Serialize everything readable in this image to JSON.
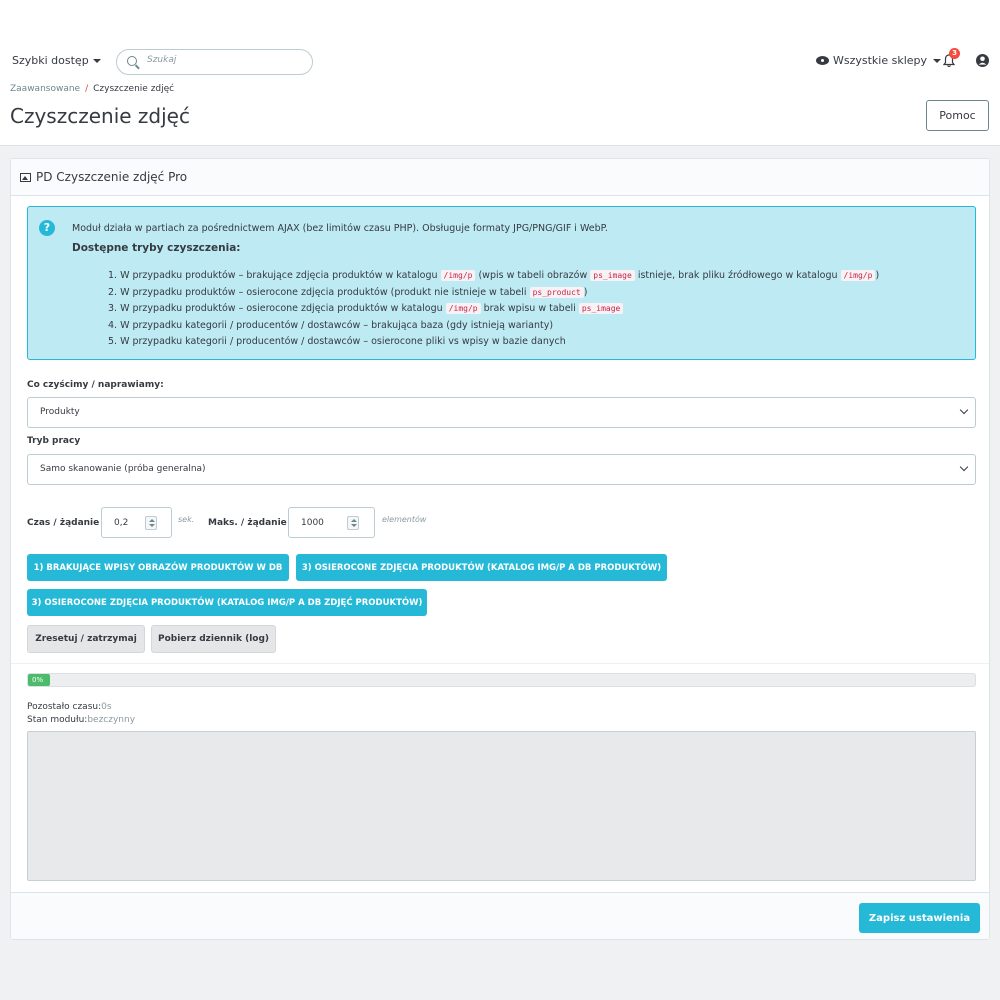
{
  "header": {
    "quick_access": "Szybki dostęp",
    "search_placeholder": "Szukaj",
    "shops": "Wszystkie sklepy",
    "notifications_count": "3"
  },
  "breadcrumb": {
    "parent": "Zaawansowane",
    "separator": "/",
    "current": "Czyszczenie zdjęć"
  },
  "page": {
    "title": "Czyszczenie zdjęć",
    "help_label": "Pomoc"
  },
  "panel": {
    "title": "PD Czyszczenie zdjęć Pro",
    "info": {
      "intro": "Moduł działa w partiach za pośrednictwem AJAX (bez limitów czasu PHP). Obsługuje formaty JPG/PNG/GIF i WebP.",
      "heading": "Dostępne tryby czyszczenia:",
      "modes": [
        {
          "t1": "1. W przypadku produktów – brakujące zdjęcia produktów w katalogu ",
          "c1": "/img/p",
          "t2": " (wpis w tabeli obrazów ",
          "c2": "ps_image",
          "t3": " istnieje, brak pliku źródłowego w katalogu ",
          "c3": "/img/p",
          "t4": ")"
        },
        {
          "t1": "2. W przypadku produktów – osierocone zdjęcia produktów (produkt nie istnieje w tabeli ",
          "c1": "ps_product",
          "t2": ")"
        },
        {
          "t1": "3. W przypadku produktów – osierocone zdjęcia produktów w katalogu ",
          "c1": "/img/p",
          "t2": " brak wpisu w tabeli ",
          "c2": "ps_image"
        },
        {
          "t1": "4. W przypadku kategorii / producentów / dostawców – brakująca baza (gdy istnieją warianty)"
        },
        {
          "t1": "5. W przypadku kategorii / producentów / dostawców – osierocone pliki vs wpisy w bazie danych"
        }
      ]
    },
    "target_label": "Co czyścimy / naprawiamy:",
    "target_value": "Produkty",
    "mode_label": "Tryb pracy",
    "mode_value": "Samo skanowanie (próba generalna)",
    "time_label": "Czas / żądanie",
    "time_value": "0,2",
    "time_unit": "sek.",
    "max_label": "Maks. / żądanie",
    "max_value": "1000",
    "max_unit": "elementów",
    "buttons": {
      "b1": "1) BRAKUJĄCE WPISY OBRAZÓW PRODUKTÓW W DB",
      "b2": "3) OSIEROCONE ZDJĘCIA PRODUKTÓW (KATALOG IMG/P A DB PRODUKTÓW)",
      "b3": "3) OSIEROCONE ZDJĘCIA PRODUKTÓW (KATALOG IMG/P A DB ZDJĘĆ PRODUKTÓW)",
      "reset": "Zresetuj / zatrzymaj",
      "download_log": "Pobierz dziennik (log)"
    },
    "progress": {
      "percent": 0,
      "label": "0%"
    },
    "time_left_label": "Pozostało czasu:",
    "time_left_value": "0s",
    "module_state_label": "Stan modułu:",
    "module_state_value": "bezczynny",
    "save_label": "Zapisz ustawienia"
  },
  "colors": {
    "accent": "#25b9d7",
    "info_bg": "#bdeaf3",
    "progress": "#4cbb6c",
    "badge": "#f54c3e"
  }
}
